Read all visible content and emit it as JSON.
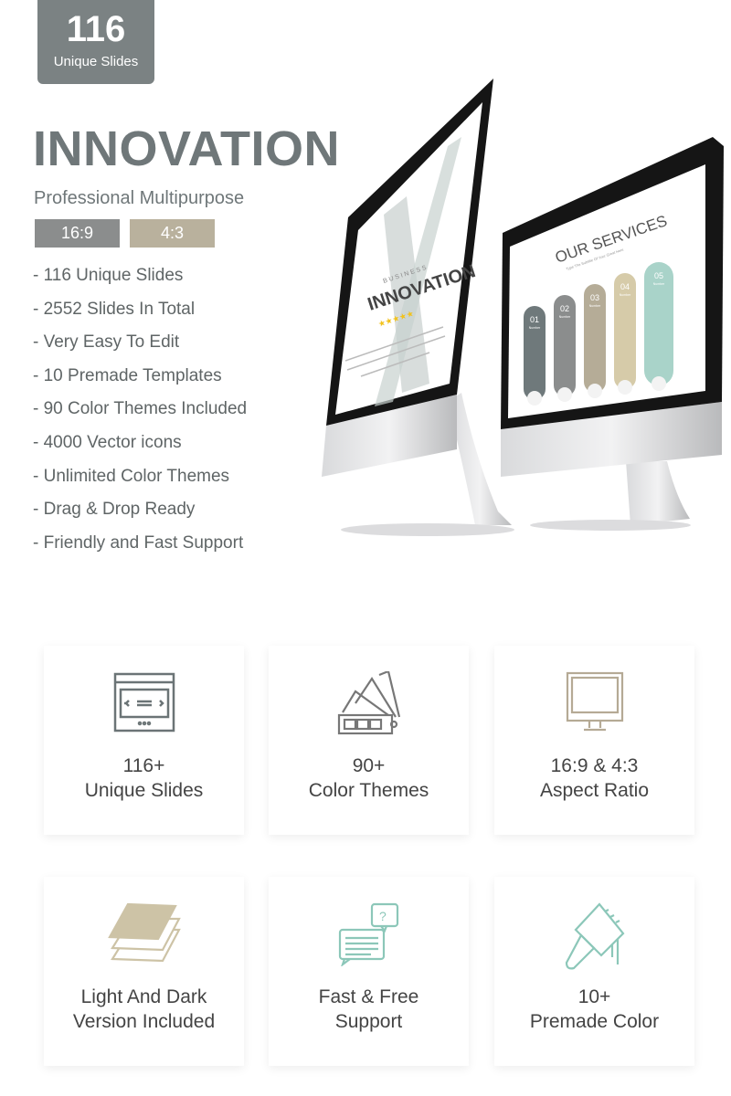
{
  "badge": {
    "number": "116",
    "label": "Unique Slides"
  },
  "title": "INNOVATION",
  "subtitle": "Professional Multipurpose",
  "ratios": [
    "16:9",
    "4:3"
  ],
  "features": [
    "- 116 Unique Slides",
    "- 2552 Slides In Total",
    "- Very Easy To Edit",
    "- 10 Premade Templates",
    "- 90 Color Themes Included",
    "- 4000 Vector icons",
    "- Unlimited Color Themes",
    "- Drag & Drop Ready",
    "- Friendly and Fast Support"
  ],
  "left_screen": {
    "kicker": "BUSINESS",
    "title": "INNOVATION",
    "stars": "★★★★★"
  },
  "right_screen": {
    "title": "OUR SERVICES",
    "subtitle": "Type The Subtitle Of Your Great Here",
    "columns": [
      {
        "num": "01",
        "label": "Number",
        "color": "#6f797b"
      },
      {
        "num": "02",
        "label": "Number",
        "color": "#8b8d8d"
      },
      {
        "num": "03",
        "label": "Number",
        "color": "#b5ac97"
      },
      {
        "num": "04",
        "label": "Number",
        "color": "#d6cba9"
      },
      {
        "num": "05",
        "label": "Number",
        "color": "#a9d3c9"
      }
    ]
  },
  "cards": [
    {
      "line1": "116+",
      "line2": "Unique Slides",
      "icon": "browser-code-icon",
      "color": "#6b7476"
    },
    {
      "line1": "90+",
      "line2": "Color Themes",
      "icon": "color-swatch-icon",
      "color": "#777"
    },
    {
      "line1": "16:9 & 4:3",
      "line2": "Aspect Ratio",
      "icon": "monitor-icon",
      "color": "#b5aa95"
    },
    {
      "line1": "Light And Dark",
      "line2": "Version Included",
      "icon": "layers-icon",
      "color": "#cdc3a6"
    },
    {
      "line1": "Fast & Free",
      "line2": "Support",
      "icon": "chat-question-icon",
      "color": "#8cc7b9"
    },
    {
      "line1": "10+",
      "line2": "Premade Color",
      "icon": "paint-brush-icon",
      "color": "#8cc7b9"
    }
  ]
}
